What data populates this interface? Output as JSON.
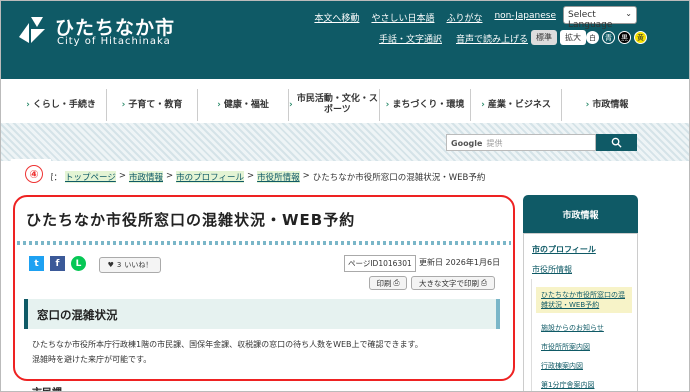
{
  "header": {
    "site_name": "ひたちなか市",
    "site_sub": "City of Hitachinaka",
    "top_links": [
      "本文へ移動",
      "やさしい日本語",
      "ふりがな",
      "non-Japanese"
    ],
    "language_select": "Select Language",
    "links2": [
      "手話・文字通訳",
      "音声で読み上げる"
    ],
    "font_size_label": "標準",
    "font_size_zoom": "拡大",
    "colors": [
      "白",
      "青",
      "黒",
      "黄"
    ],
    "brand_color": "#0f5a66"
  },
  "global_nav": [
    "くらし・手続き",
    "子育て・教育",
    "健康・福祉",
    "市民活動・文化・スポーツ",
    "まちづくり・環境",
    "産業・ビジネス",
    "市政情報"
  ],
  "search": {
    "engine": "Google",
    "placeholder": "提供",
    "button_icon": "search-icon"
  },
  "breadcrumb": {
    "prefix": "置：",
    "items": [
      "トップページ",
      "市政情報",
      "市のプロフィール",
      "市役所情報"
    ],
    "current": "ひたちなか市役所窓口の混雑状況・WEB予約",
    "separator": ">"
  },
  "annotation_number": "④",
  "main": {
    "title": "ひたちなか市役所窓口の混雑状況・WEB予約",
    "like_count": "3",
    "like_label": "いいね！",
    "page_id": "ページID1016301",
    "updated": "更新日 2026年1月6日",
    "print_label": "印刷",
    "print_large_label": "大きな文字で印刷",
    "section_title": "窓口の混雑状況",
    "body_line1": "ひたちなか市役所本庁行政棟1階の市民課、国保年金課、収税課の窓口の待ち人数をWEB上で確認できます。",
    "body_line2": "混雑時を避けた来庁が可能です。",
    "subheading": "市民課"
  },
  "sidebar": {
    "heading": "市政情報",
    "item1": "市のプロフィール",
    "item2": "市役所情報",
    "active_item": "ひたちなか市役所窓口の混雑状況・WEB予約",
    "sub_items": [
      "施設からのお知らせ",
      "市役所所案内図",
      "行政棟案内図",
      "第1分庁舎案内図"
    ]
  }
}
